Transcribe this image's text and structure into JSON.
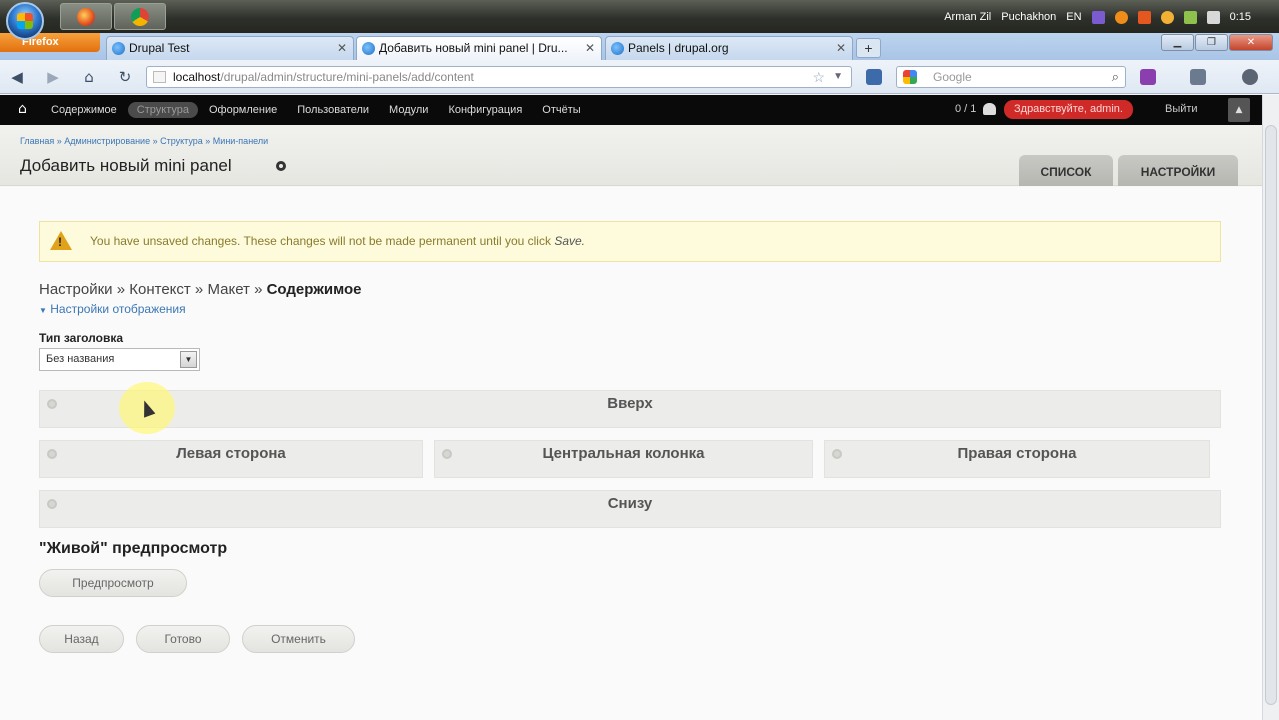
{
  "taskbar": {
    "tray_user1": "Arman Zil",
    "tray_user2": "Puchakhon",
    "language": "EN",
    "clock": "0:15"
  },
  "browser": {
    "menu_button": "Firefox",
    "tabs": [
      {
        "label": "Drupal Test"
      },
      {
        "label": "Добавить новый mini panel | Dru..."
      },
      {
        "label": "Panels | drupal.org"
      }
    ],
    "new_tab": "+",
    "url_host": "localhost",
    "url_path": "/drupal/admin/structure/mini-panels/add/content",
    "search_placeholder": "Google"
  },
  "toolbar": {
    "menu": [
      "Содержимое",
      "Структура",
      "Оформление",
      "Пользователи",
      "Модули",
      "Конфигурация",
      "Отчёты"
    ],
    "active_index": 1,
    "shortcut_count": "0 / 1",
    "greeting": "Здравствуйте, admin.",
    "logout": "Выйти"
  },
  "header": {
    "breadcrumb": "Главная » Администрирование » Структура » Мини-панели",
    "title": "Добавить новый mini panel",
    "tab_list": "СПИСОК",
    "tab_settings": "НАСТРОЙКИ"
  },
  "warning": {
    "text": "You have unsaved changes. These changes will not be made permanent until you click",
    "save_word": "Save."
  },
  "wizard": {
    "steps": [
      "Настройки",
      "Контекст",
      "Макет"
    ],
    "separator": " » ",
    "current": "Содержимое",
    "display_settings_link": "Настройки отображения"
  },
  "title_type": {
    "label": "Тип заголовка",
    "value": "Без названия"
  },
  "regions": {
    "top": "Вверх",
    "left": "Левая сторона",
    "middle": "Центральная колонка",
    "right": "Правая сторона",
    "bottom": "Снизу"
  },
  "preview": {
    "heading": "\"Живой\" предпросмотр",
    "button": "Предпросмотр"
  },
  "actions": {
    "back": "Назад",
    "finish": "Готово",
    "cancel": "Отменить"
  }
}
